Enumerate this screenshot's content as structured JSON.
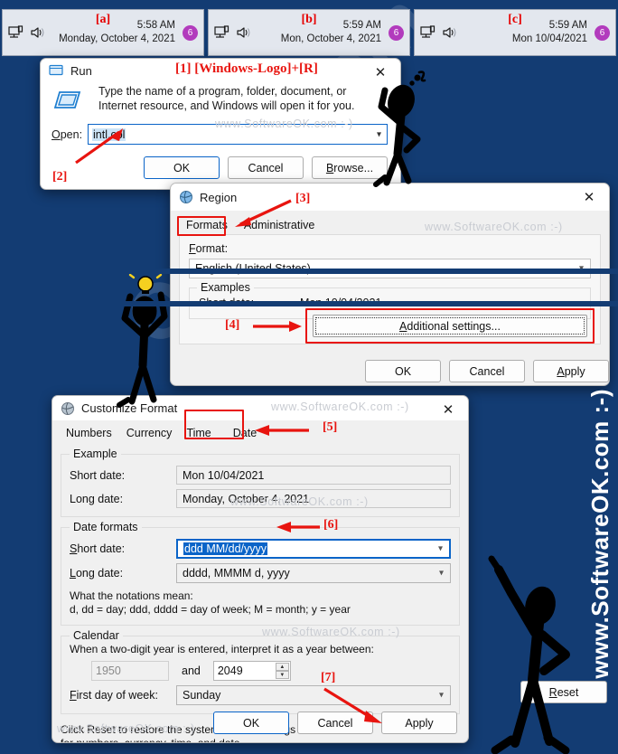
{
  "background_color": "#133c73",
  "accent_red": "#e8140f",
  "watermark": {
    "diagonal_1": "om",
    "diagonal_2": "OK",
    "vertical_right": "www.SoftwareOK.com :-)",
    "inline": "www.SoftwareOK.com  :-)"
  },
  "taskbar_clocks": [
    {
      "tag": "[a]",
      "time": "5:58 AM",
      "date": "Monday, October 4, 2021",
      "badge": "6",
      "network_icon": "network-icon",
      "volume_icon": "speaker-icon"
    },
    {
      "tag": "[b]",
      "time": "5:59 AM",
      "date": "Mon, October 4, 2021",
      "badge": "6",
      "network_icon": "network-icon",
      "volume_icon": "speaker-icon"
    },
    {
      "tag": "[c]",
      "time": "5:59 AM",
      "date": "Mon 10/04/2021",
      "badge": "6",
      "network_icon": "network-icon",
      "volume_icon": "speaker-icon"
    }
  ],
  "run_dialog": {
    "title": "Run",
    "icon": "run-window-icon",
    "close": "✕",
    "description": "Type the name of a program, folder, document, or Internet resource, and Windows will open it for you.",
    "open_label": "Open:",
    "open_value": "intl.cpl",
    "buttons": {
      "ok": "OK",
      "cancel": "Cancel",
      "browse": "Browse..."
    },
    "annotation_1": "[1] [Windows-Logo]+[R]",
    "annotation_2": "[2]"
  },
  "region_dialog": {
    "title": "Region",
    "icon": "region-globe-icon",
    "close": "✕",
    "tabs": [
      {
        "label": "Formats",
        "selected": true
      },
      {
        "label": "Administrative",
        "selected": false
      }
    ],
    "format_label": "Format:",
    "format_value": "English (United States)",
    "examples_group": "Examples",
    "short_date_label": "Short date:",
    "short_date_value": "Mon 10/04/2021",
    "additional_settings": "Additional settings...",
    "buttons": {
      "ok": "OK",
      "cancel": "Cancel",
      "apply": "Apply"
    },
    "annotation_3": "[3]",
    "annotation_4": "[4]"
  },
  "customize_dialog": {
    "title": "Customize Format",
    "icon": "region-globe-icon",
    "close": "✕",
    "tabs": [
      {
        "label": "Numbers",
        "selected": false
      },
      {
        "label": "Currency",
        "selected": false
      },
      {
        "label": "Time",
        "selected": false
      },
      {
        "label": "Date",
        "selected": true
      }
    ],
    "example_group": "Example",
    "example_short_label": "Short date:",
    "example_short_value": "Mon 10/04/2021",
    "example_long_label": "Long date:",
    "example_long_value": "Monday, October 4, 2021",
    "formats_group": "Date formats",
    "short_date_label": "Short date:",
    "short_date_value": "ddd MM/dd/yyyy",
    "long_date_label": "Long date:",
    "long_date_value": "dddd, MMMM d, yyyy",
    "notations_title": "What the notations mean:",
    "notations_body": "d, dd = day;  ddd, dddd = day of week;  M = month;  y = year",
    "calendar_group": "Calendar",
    "calendar_note": "When a two-digit year is entered, interpret it as a year between:",
    "year_from": "1950",
    "year_and": "and",
    "year_to": "2049",
    "first_day_label": "First day of week:",
    "first_day_value": "Sunday",
    "reset_text": "Click Reset to restore the system default settings for numbers, currency, time, and date.",
    "reset_button": "Reset",
    "buttons": {
      "ok": "OK",
      "cancel": "Cancel",
      "apply": "Apply"
    },
    "annotation_5": "[5]",
    "annotation_6": "[6]",
    "annotation_7": "[7]"
  }
}
